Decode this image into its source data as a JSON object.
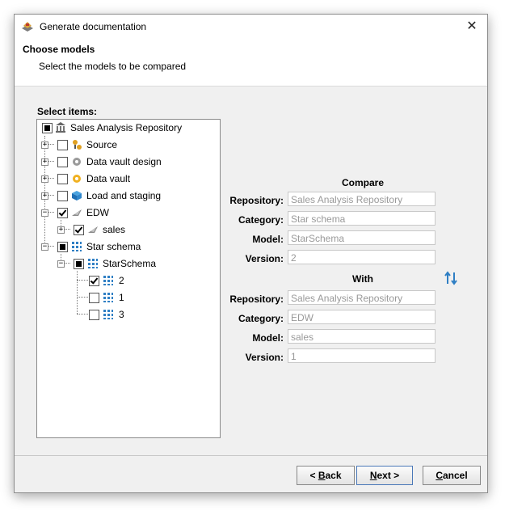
{
  "window": {
    "title": "Generate documentation"
  },
  "header": {
    "title": "Choose models",
    "subtitle": "Select the models to be compared"
  },
  "tree": {
    "label": "Select items:",
    "nodes": [
      {
        "label": "Sales Analysis Repository",
        "icon": "repository-icon",
        "state": "partial"
      },
      {
        "label": "Source",
        "icon": "source-icon",
        "state": "unchecked"
      },
      {
        "label": "Data vault design",
        "icon": "data-vault-design-icon",
        "state": "unchecked"
      },
      {
        "label": "Data vault",
        "icon": "data-vault-icon",
        "state": "unchecked"
      },
      {
        "label": "Load and staging",
        "icon": "cube-icon",
        "state": "unchecked"
      },
      {
        "label": "EDW",
        "icon": "edw-icon",
        "state": "checked"
      },
      {
        "label": "sales",
        "icon": "edw-model-icon",
        "state": "checked"
      },
      {
        "label": "Star schema",
        "icon": "star-schema-icon",
        "state": "partial"
      },
      {
        "label": "StarSchema",
        "icon": "star-schema-model-icon",
        "state": "partial"
      },
      {
        "label": "2",
        "icon": "version-icon",
        "state": "checked"
      },
      {
        "label": "1",
        "icon": "version-icon",
        "state": "unchecked"
      },
      {
        "label": "3",
        "icon": "version-icon",
        "state": "unchecked"
      }
    ]
  },
  "compare": {
    "title": "Compare",
    "repository_label": "Repository:",
    "repository": "Sales Analysis Repository",
    "category_label": "Category:",
    "category": "Star schema",
    "model_label": "Model:",
    "model": "StarSchema",
    "version_label": "Version:",
    "version": "2"
  },
  "with": {
    "title": "With",
    "repository_label": "Repository:",
    "repository": "Sales Analysis Repository",
    "category_label": "Category:",
    "category": "EDW",
    "model_label": "Model:",
    "model": "sales",
    "version_label": "Version:",
    "version": "1"
  },
  "buttons": {
    "back_mnemonic": "B",
    "back_rest": "ack",
    "back_prefix": "< ",
    "next_mnemonic": "N",
    "next_rest": "ext",
    "next_suffix": " >",
    "cancel_mnemonic": "C",
    "cancel_rest": "ancel"
  },
  "colors": {
    "accent_blue": "#2f7fc4",
    "field_text": "#999999"
  }
}
